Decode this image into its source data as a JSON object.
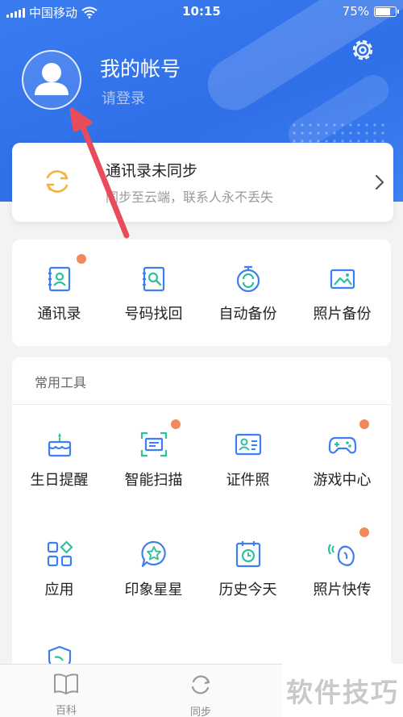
{
  "status_bar": {
    "carrier": "中国移动",
    "time": "10:15",
    "battery": "75%",
    "battery_level": 0.75
  },
  "profile": {
    "username": "我的帐号",
    "login_hint": "请登录"
  },
  "sync": {
    "title": "通讯录未同步",
    "subtitle": "同步至云端，联系人永不丢失"
  },
  "functions": [
    {
      "label": "通讯录",
      "icon": "contacts-icon",
      "badge": true
    },
    {
      "label": "号码找回",
      "icon": "number-recovery-icon",
      "badge": false
    },
    {
      "label": "自动备份",
      "icon": "auto-backup-icon",
      "badge": false
    },
    {
      "label": "照片备份",
      "icon": "photo-backup-icon",
      "badge": false
    }
  ],
  "tools": {
    "title": "常用工具",
    "items": [
      {
        "label": "生日提醒",
        "icon": "birthday-cake-icon",
        "badge": false
      },
      {
        "label": "智能扫描",
        "icon": "scan-icon",
        "badge": true
      },
      {
        "label": "证件照",
        "icon": "id-card-icon",
        "badge": false
      },
      {
        "label": "游戏中心",
        "icon": "gamepad-icon",
        "badge": true
      },
      {
        "label": "应用",
        "icon": "apps-grid-icon",
        "badge": false
      },
      {
        "label": "印象星星",
        "icon": "star-bubble-icon",
        "badge": false
      },
      {
        "label": "历史今天",
        "icon": "history-calendar-icon",
        "badge": false
      },
      {
        "label": "照片快传",
        "icon": "photo-transfer-icon",
        "badge": true
      }
    ]
  },
  "tabbar": {
    "tabs": [
      {
        "label": "百科",
        "icon": "book-icon"
      },
      {
        "label": "同步",
        "icon": "sync-icon"
      }
    ]
  },
  "watermark": "软件技巧",
  "colors": {
    "header": "#2f6fe8",
    "icon_blue": "#3d7ff0",
    "icon_green": "#2cc1a0",
    "badge": "#f08a5d",
    "arrow": "#ea4b5a",
    "sync_icon": "#f3b43f"
  }
}
